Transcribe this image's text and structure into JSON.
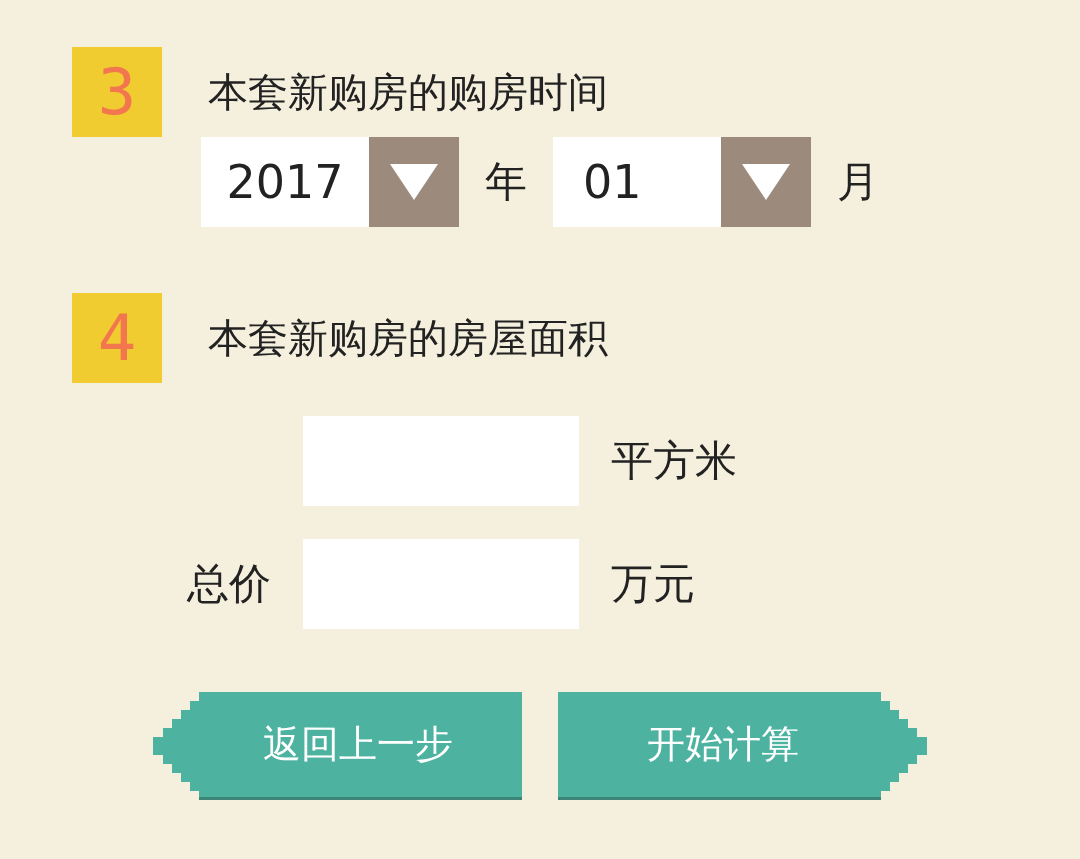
{
  "steps": [
    {
      "number": "3",
      "title": "本套新购房的购房时间",
      "kind": "date",
      "year": {
        "value": "2017",
        "unit": "年"
      },
      "month": {
        "value": "01",
        "unit": "月"
      }
    },
    {
      "number": "4",
      "title": "本套新购房的房屋面积",
      "kind": "area",
      "fields": [
        {
          "unit": "平方米"
        },
        {
          "label": "总价",
          "unit": "万元"
        }
      ]
    }
  ],
  "buttons": [
    {
      "label": "返回上一步",
      "kind": "back"
    },
    {
      "label": "开始计算",
      "kind": "next"
    }
  ]
}
